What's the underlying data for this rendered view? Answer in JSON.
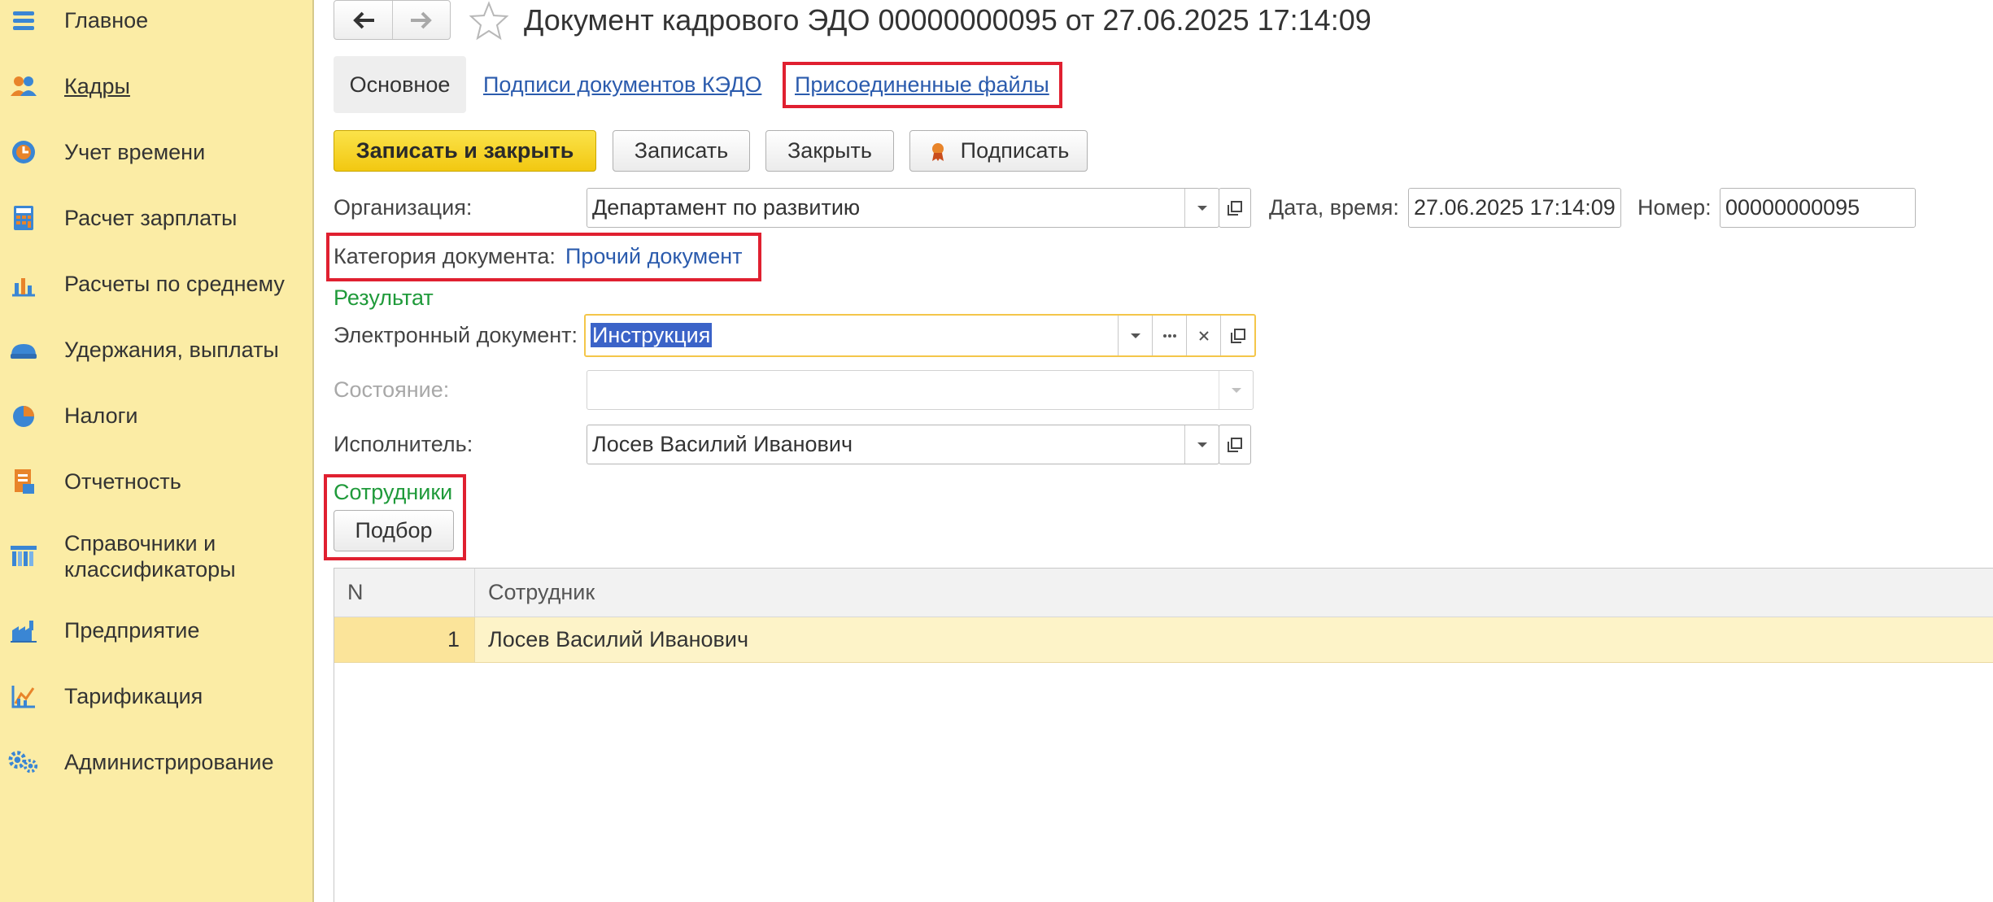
{
  "sidebar": {
    "items": [
      {
        "label": "Главное",
        "icon": "menu-icon"
      },
      {
        "label": "Кадры",
        "icon": "people-icon",
        "active": true
      },
      {
        "label": "Учет времени",
        "icon": "clock-icon"
      },
      {
        "label": "Расчет зарплаты",
        "icon": "calculator-icon"
      },
      {
        "label": "Расчеты по среднему",
        "icon": "bar-chart-icon"
      },
      {
        "label": "Удержания, выплаты",
        "icon": "wallet-icon"
      },
      {
        "label": "Налоги",
        "icon": "pie-chart-icon"
      },
      {
        "label": "Отчетность",
        "icon": "report-icon"
      },
      {
        "label": "Справочники и классификаторы",
        "line1": "Справочники и",
        "line2": "классификаторы",
        "icon": "catalog-icon"
      },
      {
        "label": "Предприятие",
        "icon": "factory-icon"
      },
      {
        "label": "Тарификация",
        "icon": "tariff-chart-icon"
      },
      {
        "label": "Администрирование",
        "icon": "gears-icon"
      }
    ]
  },
  "header": {
    "title": "Документ кадрового ЭДО 00000000095 от 27.06.2025 17:14:09"
  },
  "tabs": {
    "main": "Основное",
    "signatures": "Подписи документов КЭДО",
    "attached_files": "Присоединенные файлы"
  },
  "toolbar": {
    "save_close": "Записать и закрыть",
    "save": "Записать",
    "close": "Закрыть",
    "sign": "Подписать"
  },
  "form": {
    "organization_label": "Организация:",
    "organization_value": "Департамент по развитию",
    "datetime_label": "Дата, время:",
    "datetime_value": "27.06.2025 17:14:09",
    "number_label": "Номер:",
    "number_value": "00000000095",
    "category_label": "Категория документа:",
    "category_value": "Прочий документ",
    "result_title": "Результат",
    "edoc_label": "Электронный документ:",
    "edoc_value": "Инструкция",
    "state_label": "Состояние:",
    "state_value": "",
    "executor_label": "Исполнитель:",
    "executor_value": "Лосев Василий Иванович",
    "employees_title": "Сотрудники",
    "pick_button": "Подбор"
  },
  "table": {
    "columns": [
      "N",
      "Сотрудник"
    ],
    "rows": [
      {
        "n": "1",
        "employee": "Лосев Василий Иванович"
      }
    ]
  },
  "colors": {
    "sidebar_bg": "#fbeca5",
    "primary_button": "#f2c811",
    "link": "#2b5bad",
    "group_title": "#1f9a3a",
    "highlight_box": "#e02030",
    "selected_row": "#fdf3c8"
  }
}
